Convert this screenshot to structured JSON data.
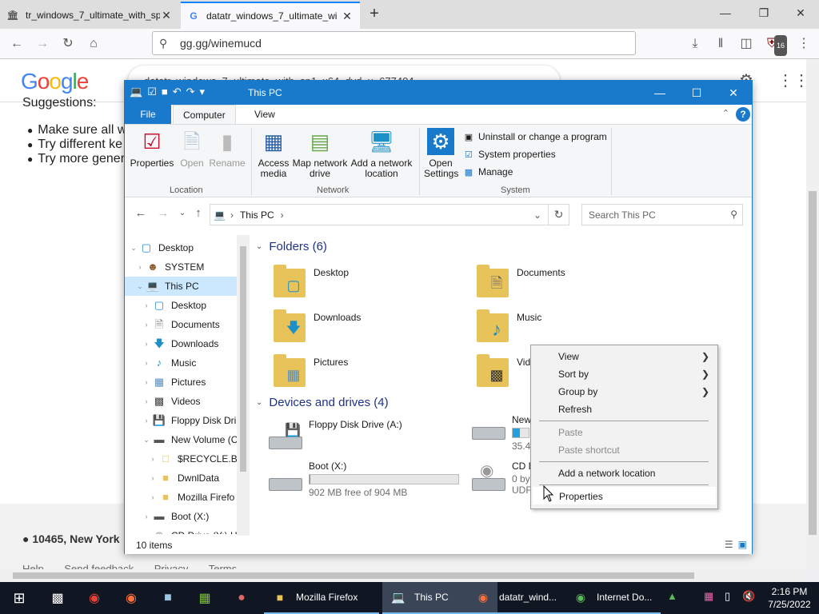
{
  "browser": {
    "tabs": [
      {
        "label": "tr_windows_7_ultimate_with_sp",
        "icon": "library-icon"
      },
      {
        "label": "datatr_windows_7_ultimate_wi",
        "icon": "google-icon"
      }
    ],
    "url": "gg.gg/winemucd",
    "addon_badge": "16"
  },
  "google": {
    "logo": "Google",
    "search_text": "datatr_windows_7_ultimate_with_sp1_x64_dvd_u_677404",
    "suggestions_heading": "Suggestions:",
    "suggestions": [
      "Make sure all w",
      "Try different ke",
      "Try more gener"
    ],
    "location": "10465, New York",
    "footer_links": [
      "Help",
      "Send feedback",
      "Privacy",
      "Terms"
    ]
  },
  "explorer": {
    "title": "This PC",
    "ribbon_tabs": {
      "file": "File",
      "computer": "Computer",
      "view": "View"
    },
    "ribbon": {
      "properties": "Properties",
      "open": "Open",
      "rename": "Rename",
      "access_media": "Access media",
      "map_drive": "Map network drive",
      "add_location": "Add a network location",
      "open_settings": "Open Settings",
      "uninstall": "Uninstall or change a program",
      "system_properties": "System properties",
      "manage": "Manage",
      "group_location": "Location",
      "group_network": "Network",
      "group_system": "System"
    },
    "address": {
      "path": "This PC",
      "search_placeholder": "Search This PC"
    },
    "nav": [
      {
        "label": "Desktop",
        "icon": "desktop-icon"
      },
      {
        "label": "SYSTEM",
        "icon": "user-icon"
      },
      {
        "label": "This PC",
        "icon": "computer-icon"
      },
      {
        "label": "Desktop",
        "icon": "desktop-icon"
      },
      {
        "label": "Documents",
        "icon": "documents-icon"
      },
      {
        "label": "Downloads",
        "icon": "download-icon"
      },
      {
        "label": "Music",
        "icon": "music-icon"
      },
      {
        "label": "Pictures",
        "icon": "pictures-icon"
      },
      {
        "label": "Videos",
        "icon": "videos-icon"
      },
      {
        "label": "Floppy Disk Dri",
        "icon": "floppy-icon"
      },
      {
        "label": "New Volume (C",
        "icon": "drive-icon"
      },
      {
        "label": "$RECYCLE.BIN",
        "icon": "folder-icon"
      },
      {
        "label": "DwnlData",
        "icon": "folder-icon"
      },
      {
        "label": "Mozilla Firefo",
        "icon": "folder-icon"
      },
      {
        "label": "Boot (X:)",
        "icon": "drive-icon"
      },
      {
        "label": "CD Drive (Y:) H",
        "icon": "cd-icon"
      }
    ],
    "folders_heading": "Folders (6)",
    "folders": [
      "Desktop",
      "Documents",
      "Downloads",
      "Music",
      "Pictures",
      "Vide"
    ],
    "drives_heading": "Devices and drives (4)",
    "drives": [
      {
        "name": "Floppy Disk Drive (A:)",
        "sub": "",
        "fill": null
      },
      {
        "name": "New",
        "sub": "35.4",
        "fill": 0.45
      },
      {
        "name": "Boot (X:)",
        "sub": "902 MB free of 904 MB",
        "fill": 0.002
      },
      {
        "name": "CD D",
        "sub": "0 by",
        "sub2": "UDF",
        "fill": null
      }
    ],
    "status": "10 items"
  },
  "context_menu": {
    "view": "View",
    "sort_by": "Sort by",
    "group_by": "Group by",
    "refresh": "Refresh",
    "paste": "Paste",
    "paste_shortcut": "Paste shortcut",
    "add_network_location": "Add a network location",
    "properties": "Properties"
  },
  "taskbar": {
    "apps": [
      {
        "label": "Mozilla Firefox",
        "icon": "folder-icon"
      },
      {
        "label": "This PC",
        "icon": "computer-icon"
      },
      {
        "label": "datatr_wind...",
        "icon": "firefox-icon"
      },
      {
        "label": "Internet Do...",
        "icon": "globe-icon"
      }
    ],
    "time": "2:16 PM",
    "date": "7/25/2022"
  }
}
